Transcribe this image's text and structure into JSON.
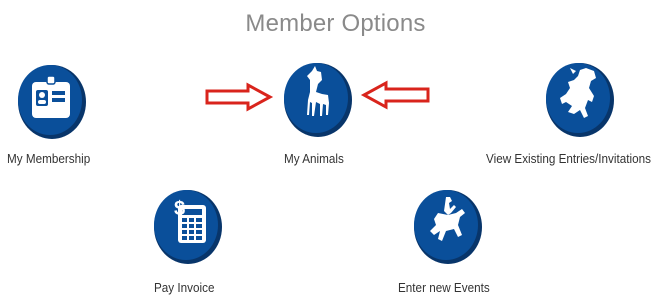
{
  "title": "Member Options",
  "options": [
    {
      "label": "My Membership",
      "icon": "id-badge-icon"
    },
    {
      "label": "My Animals",
      "icon": "horse-icon"
    },
    {
      "label": "View Existing Entries/Invitations",
      "icon": "bucking-bull-icon"
    },
    {
      "label": "Pay Invoice",
      "icon": "invoice-calculator-icon"
    },
    {
      "label": "Enter new Events",
      "icon": "bronc-rider-icon"
    }
  ],
  "annotations": {
    "arrow_color": "#d9241c",
    "arrows": [
      "arrow-right-icon",
      "arrow-left-icon"
    ]
  },
  "colors": {
    "circle_blue": "#0a4f9a",
    "circle_shadow": "#08356a",
    "title_gray": "#8a8a8a",
    "label_dark": "#333333"
  }
}
